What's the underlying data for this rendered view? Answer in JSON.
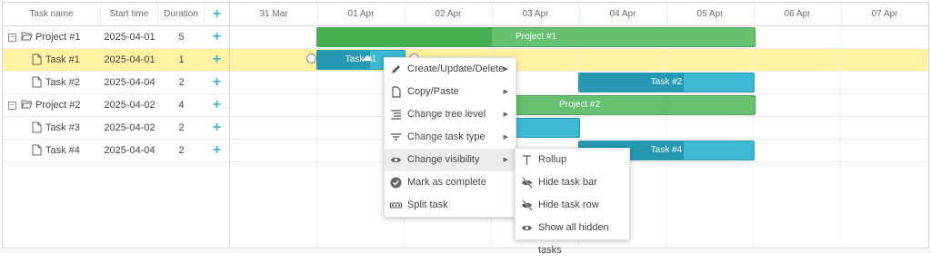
{
  "grid": {
    "headers": {
      "name": "Task name",
      "start": "Start time",
      "duration": "Duration",
      "add": "+"
    },
    "rows": [
      {
        "name": "Project #1",
        "start": "2025-04-01",
        "duration": "5",
        "add": "+",
        "type": "project"
      },
      {
        "name": "Task #1",
        "start": "2025-04-01",
        "duration": "1",
        "add": "+",
        "type": "task"
      },
      {
        "name": "Task #2",
        "start": "2025-04-04",
        "duration": "2",
        "add": "+",
        "type": "task"
      },
      {
        "name": "Project #2",
        "start": "2025-04-02",
        "duration": "4",
        "add": "+",
        "type": "project"
      },
      {
        "name": "Task #3",
        "start": "2025-04-02",
        "duration": "2",
        "add": "+",
        "type": "task"
      },
      {
        "name": "Task #4",
        "start": "2025-04-04",
        "duration": "2",
        "add": "+",
        "type": "task"
      }
    ],
    "toggle_symbol": "−"
  },
  "timeline": {
    "scale": [
      "31 Mar",
      "01 Apr",
      "02 Apr",
      "03 Apr",
      "04 Apr",
      "05 Apr",
      "06 Apr",
      "07 Apr"
    ],
    "bars": {
      "project1": "Project #1",
      "task1": "Task #1",
      "task2": "Task #2",
      "project2": "Project #2",
      "task4": "Task #4"
    },
    "progress": {
      "project1": 0.4,
      "task1": 0.6,
      "task2": 0.6,
      "project2": 0.12,
      "task4": 0.6
    }
  },
  "context_menu": {
    "items": [
      {
        "label": "Create/Update/Delete",
        "icon": "pencil-icon",
        "submenu": true
      },
      {
        "label": "Copy/Paste",
        "icon": "document-icon",
        "submenu": true
      },
      {
        "label": "Change tree level",
        "icon": "indent-icon",
        "submenu": true
      },
      {
        "label": "Change task type",
        "icon": "filter-icon",
        "submenu": true
      },
      {
        "label": "Change visibility",
        "icon": "eye-icon",
        "submenu": true
      },
      {
        "label": "Mark as complete",
        "icon": "check-circle-icon",
        "submenu": false
      },
      {
        "label": "Split task",
        "icon": "split-icon",
        "submenu": false
      }
    ],
    "submenu_arrow": "▶"
  },
  "visibility_submenu": {
    "items": [
      {
        "label": "Rollup",
        "icon": "rollup-icon"
      },
      {
        "label": "Hide task bar",
        "icon": "eye-off-icon"
      },
      {
        "label": "Hide task row",
        "icon": "eye-off-icon"
      },
      {
        "label": "Show all hidden tasks",
        "icon": "eye-icon"
      }
    ]
  },
  "colors": {
    "accent": "#3db9d3",
    "project": "#65c16f",
    "selected_row": "#fff3a1"
  }
}
